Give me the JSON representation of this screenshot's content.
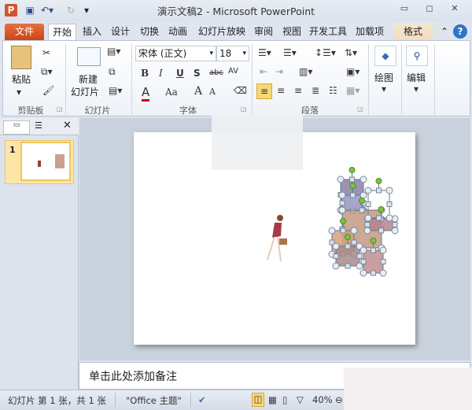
{
  "window": {
    "title": "演示文稿2 - Microsoft PowerPoint",
    "app_icon": "P"
  },
  "tabs": [
    "文件",
    "开始",
    "插入",
    "设计",
    "切换",
    "动画",
    "幻灯片放映",
    "审阅",
    "视图",
    "开发工具",
    "加载项",
    "格式"
  ],
  "ribbon": {
    "clipboard": {
      "label": "剪贴板",
      "paste": "粘贴"
    },
    "slides": {
      "label": "幻灯片",
      "new_slide_line1": "新建",
      "new_slide_line2": "幻灯片"
    },
    "font": {
      "label": "字体",
      "font_name": "宋体 (正文)",
      "font_size": "18",
      "bold": "B",
      "italic": "I",
      "underline": "U",
      "shadow": "S",
      "strike": "abc",
      "spacing": "AV",
      "color": "A",
      "case": "Aa",
      "grow": "A",
      "shrink": "A"
    },
    "paragraph": {
      "label": "段落"
    },
    "drawing": {
      "label": "绘图"
    },
    "editing": {
      "label": "编辑"
    }
  },
  "notes": {
    "placeholder": "单击此处添加备注"
  },
  "thumbnail": {
    "number": "1"
  },
  "status": {
    "slide_info": "幻灯片 第 1 张，共 1 张",
    "theme": "\"Office 主题\"",
    "zoom": "40%"
  },
  "colors": {
    "file_tab": "#d2532a",
    "accent_selected": "#f0c65a",
    "handle_green": "#7dc242"
  }
}
